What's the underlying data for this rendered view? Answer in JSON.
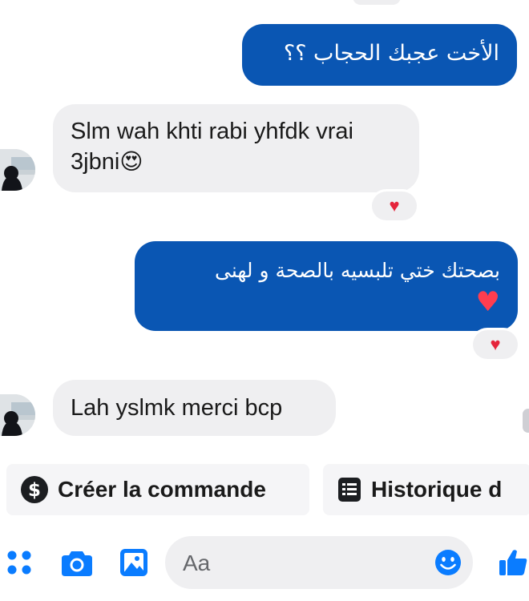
{
  "thread": {
    "messages": [
      {
        "direction": "outgoing",
        "text": "الأخت عجبك الحجاب ؟؟"
      },
      {
        "direction": "incoming",
        "text": "Slm wah khti rabi yhfdk vrai 3jbni",
        "emoji": "😍",
        "reaction": "♥"
      },
      {
        "direction": "outgoing",
        "text": "بصحتك ختي تلبسيه بالصحة و لهنى",
        "emoji": "♥",
        "reaction": "♥"
      },
      {
        "direction": "incoming",
        "text": "Lah yslmk merci bcp"
      }
    ]
  },
  "quick_actions": [
    {
      "label": "Créer la commande",
      "icon": "dollar-circle-icon"
    },
    {
      "label": "Historique d",
      "icon": "receipt-icon"
    }
  ],
  "composer": {
    "placeholder": "Aa",
    "icons": [
      "apps-icon",
      "camera-icon",
      "gallery-icon",
      "emoji-icon",
      "thumbs-up-icon"
    ]
  },
  "colors": {
    "accent": "#0a56b3",
    "incoming_bubble": "#efeff1",
    "reaction_heart": "#e5243b",
    "toolbar_icon": "#0a7cff"
  }
}
